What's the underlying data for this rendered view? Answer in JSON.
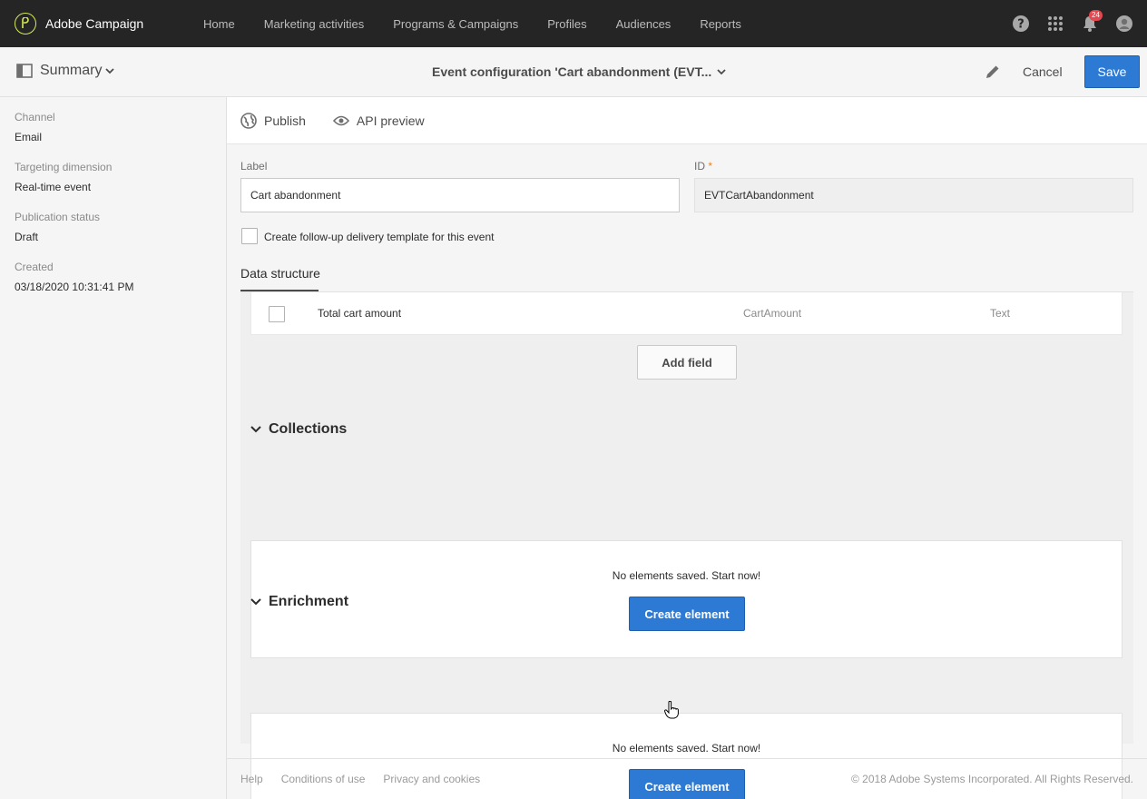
{
  "app": {
    "name": "Adobe Campaign"
  },
  "nav": {
    "items": [
      {
        "label": "Home"
      },
      {
        "label": "Marketing activities"
      },
      {
        "label": "Programs & Campaigns"
      },
      {
        "label": "Profiles"
      },
      {
        "label": "Audiences"
      },
      {
        "label": "Reports"
      }
    ],
    "notifications_count": "24"
  },
  "header": {
    "summary_label": "Summary",
    "title": "Event configuration 'Cart abandonment (EVT...",
    "cancel_label": "Cancel",
    "save_label": "Save"
  },
  "properties": [
    {
      "key": "Channel",
      "value": "Email"
    },
    {
      "key": "Targeting dimension",
      "value": "Real-time event"
    },
    {
      "key": "Publication status",
      "value": "Draft"
    },
    {
      "key": "Created",
      "value": "03/18/2020 10:31:41 PM"
    }
  ],
  "toolbar": {
    "publish_label": "Publish",
    "api_preview_label": "API preview"
  },
  "form": {
    "label_label": "Label",
    "label_value": "Cart abandonment",
    "id_label": "ID",
    "id_required_mark": "*",
    "id_value": "EVTCartAbandonment",
    "followup_label": "Create follow-up delivery template for this event"
  },
  "tabs": {
    "data_structure": "Data structure"
  },
  "data_structure": {
    "rows": [
      {
        "label": "Total cart amount",
        "id": "CartAmount",
        "type": "Text"
      }
    ],
    "add_field_label": "Add field"
  },
  "collections": {
    "title": "Collections",
    "empty_text": "No elements saved. Start now!",
    "create_label": "Create element"
  },
  "enrichment": {
    "title": "Enrichment",
    "empty_text": "No elements saved. Start now!",
    "create_label": "Create element"
  },
  "footer": {
    "links": [
      {
        "label": "Help"
      },
      {
        "label": "Conditions of use"
      },
      {
        "label": "Privacy and cookies"
      }
    ],
    "copyright": "© 2018 Adobe Systems Incorporated. All Rights Reserved."
  },
  "colors": {
    "accent": "#2d7ad4",
    "topbar": "#252525",
    "brand_logo": "#d7e95a",
    "badge": "#e34850"
  }
}
